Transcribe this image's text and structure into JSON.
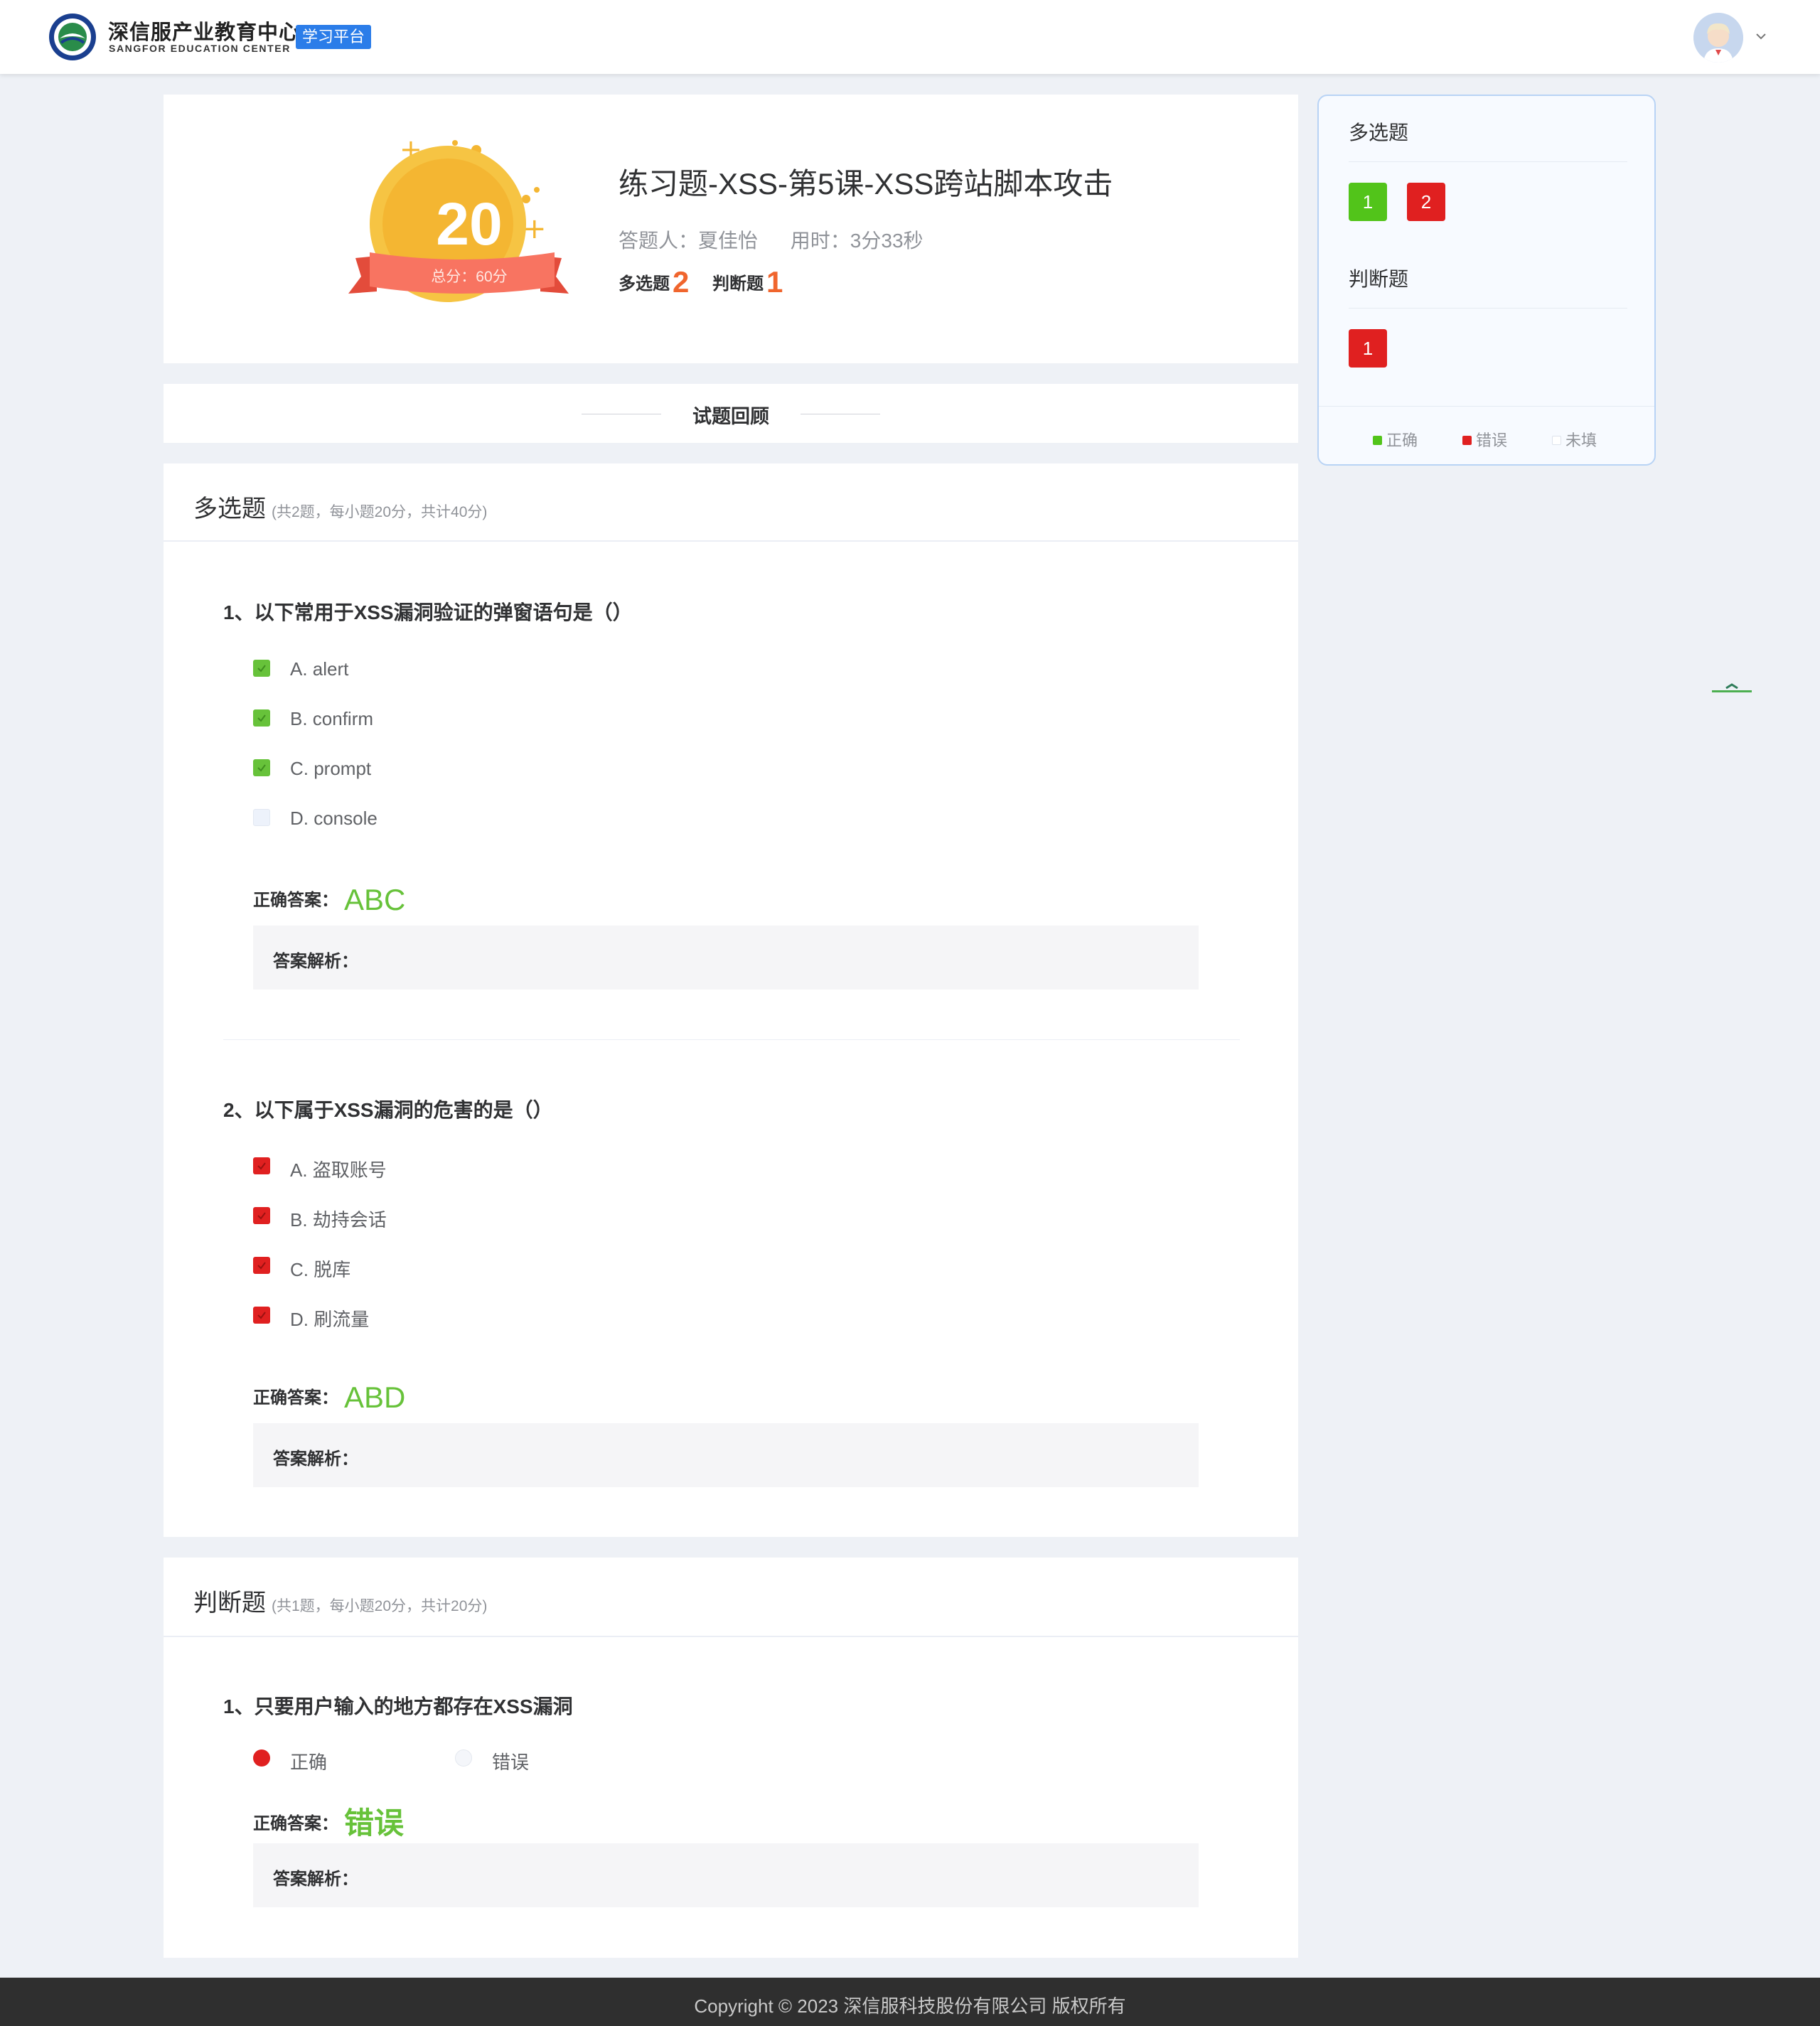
{
  "header": {
    "logo_cn": "深信服产业教育中心",
    "logo_en": "SANGFOR EDUCATION CENTER",
    "platform": "学习平台"
  },
  "summary": {
    "score": "20",
    "total": "总分：60分",
    "title": "练习题-XSS-第5课-XSS跨站脚本攻击",
    "answerer": "答题人：夏佳怡",
    "duration": "用时：3分33秒",
    "counts": [
      {
        "label": "多选题",
        "value": "2"
      },
      {
        "label": "判断题",
        "value": "1"
      }
    ]
  },
  "review": {
    "title": "试题回顾"
  },
  "multi": {
    "heading": "多选题",
    "sub": "(共2题，每小题20分，共计40分)",
    "questions": [
      {
        "title": "1、以下常用于XSS漏洞验证的弹窗语句是（）",
        "options": [
          "A. alert",
          "B. confirm",
          "C. prompt",
          "D. console"
        ],
        "states": [
          "ok",
          "ok",
          "ok",
          "none"
        ],
        "answer_label": "正确答案：",
        "answer": "ABC",
        "analysis": "答案解析："
      },
      {
        "title": "2、以下属于XSS漏洞的危害的是（）",
        "options": [
          "A. 盗取账号",
          "B. 劫持会话",
          "C. 脱库",
          "D. 刷流量"
        ],
        "states": [
          "bad",
          "bad",
          "bad",
          "bad"
        ],
        "answer_label": "正确答案：",
        "answer": "ABD",
        "analysis": "答案解析："
      }
    ]
  },
  "judge": {
    "heading": "判断题",
    "sub": "(共1题，每小题20分，共计20分)",
    "questions": [
      {
        "title": "1、只要用户输入的地方都存在XSS漏洞",
        "options": [
          "正确",
          "错误"
        ],
        "selected": "正确",
        "answer_label": "正确答案：",
        "answer": "错误",
        "analysis": "答案解析："
      }
    ]
  },
  "sidebar": {
    "groups": [
      {
        "title": "多选题",
        "items": [
          {
            "num": "1",
            "status": "correct"
          },
          {
            "num": "2",
            "status": "wrong"
          }
        ]
      },
      {
        "title": "判断题",
        "items": [
          {
            "num": "1",
            "status": "wrong"
          }
        ]
      }
    ],
    "legend": [
      {
        "label": "正确",
        "color": "#52c41a"
      },
      {
        "label": "错误",
        "color": "#e02020"
      },
      {
        "label": "未填",
        "color": "#ffffff"
      }
    ]
  },
  "footer": {
    "copyright": "Copyright © 2023 深信服科技股份有限公司 版权所有"
  },
  "colors": {
    "correct": "#52c41a",
    "wrong": "#e02020",
    "answer": "#67c23a",
    "accent": "#f0652d",
    "brand": "#2b7de9"
  }
}
